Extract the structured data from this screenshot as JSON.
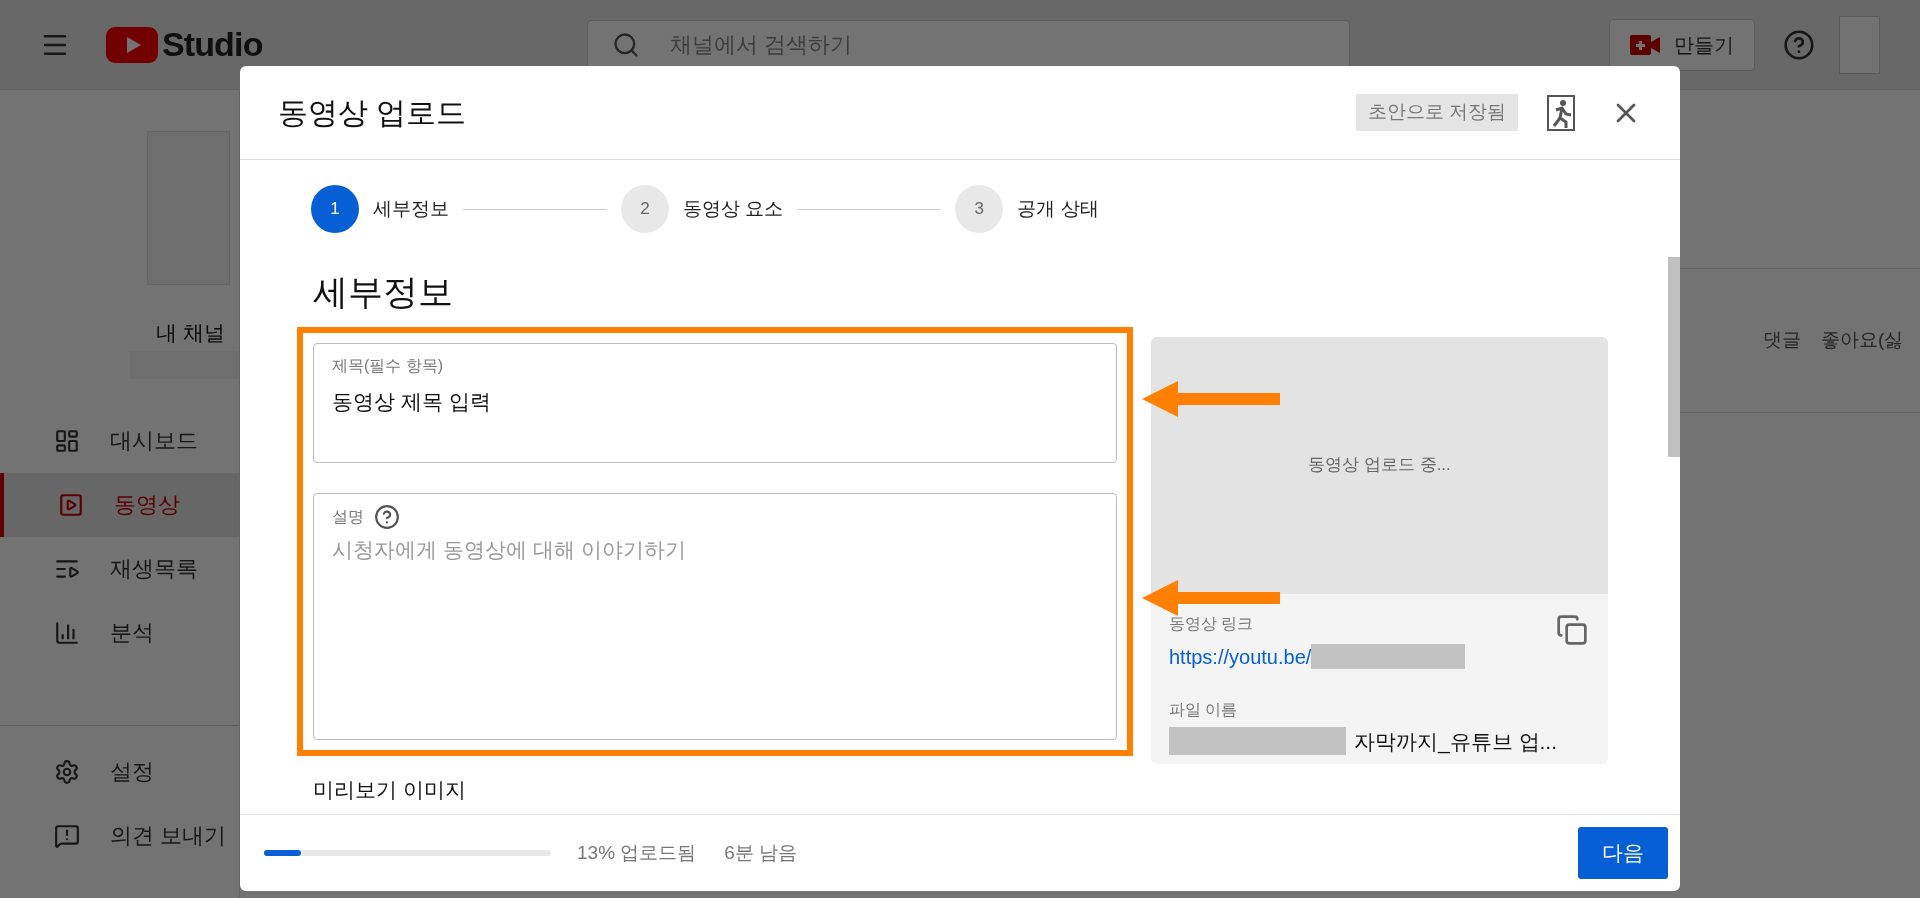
{
  "topbar": {
    "logo_text": "Studio",
    "search": {
      "placeholder": "채널에서 검색하기"
    },
    "create_button": "만들기"
  },
  "sidebar": {
    "channel_label": "내 채널",
    "items": [
      {
        "label": "대시보드",
        "selected": false
      },
      {
        "label": "동영상",
        "selected": true
      },
      {
        "label": "재생목록",
        "selected": false
      },
      {
        "label": "분석",
        "selected": false
      }
    ],
    "bottom_items": [
      {
        "label": "설정",
        "selected": false
      },
      {
        "label": "의견 보내기",
        "selected": false
      }
    ]
  },
  "background_table": {
    "columns": [
      "댓글",
      "좋아요(싫"
    ]
  },
  "dialog": {
    "title": "동영상 업로드",
    "saved_badge": "초안으로 저장됨",
    "steps": [
      {
        "number": "1",
        "label": "세부정보",
        "selected": true
      },
      {
        "number": "2",
        "label": "동영상 요소",
        "selected": false
      },
      {
        "number": "3",
        "label": "공개 상태",
        "selected": false
      }
    ],
    "section_title": "세부정보",
    "title_field": {
      "label": "제목(필수 항목)",
      "value": "동영상 제목 입력"
    },
    "description_field": {
      "label": "설명",
      "placeholder": "시청자에게 동영상에 대해 이야기하기"
    },
    "preview": {
      "status": "동영상 업로드 중...",
      "link_label": "동영상 링크",
      "link": "https://youtu.be/",
      "filename_label": "파일 이름",
      "filename": "자막까지_유튜브 업..."
    },
    "thumbnail_label": "미리보기 이미지",
    "upload": {
      "level": 0.13,
      "percent": "13% 업로드됨",
      "remaining": "6분 남음"
    },
    "next_button": "다음"
  },
  "annotations": [
    {
      "kind": "box"
    },
    {
      "kind": "arrow"
    },
    {
      "kind": "arrow"
    }
  ]
}
